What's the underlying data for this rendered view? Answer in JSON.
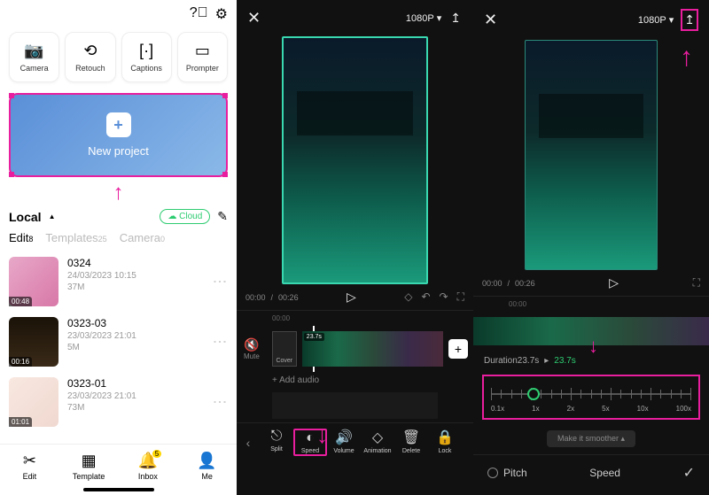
{
  "left": {
    "tools": [
      {
        "icon": "📷",
        "label": "Camera"
      },
      {
        "icon": "⟲",
        "label": "Retouch"
      },
      {
        "icon": "[·]",
        "label": "Captions"
      },
      {
        "icon": "▭",
        "label": "Prompter"
      }
    ],
    "new_project": "New project",
    "section_local": "Local",
    "cloud_btn": "☁ Cloud",
    "tabs": {
      "edit": "Edit",
      "edit_count": "8",
      "templates": "Templates",
      "templates_count": "25",
      "camera": "Camera",
      "camera_count": "0"
    },
    "projects": [
      {
        "title": "0324",
        "date": "24/03/2023 10:15",
        "size": "37M",
        "dur": "00:48",
        "bg": "linear-gradient(135deg,#e8a8c8,#d878a8)"
      },
      {
        "title": "0323-03",
        "date": "23/03/2023 21:01",
        "size": "5M",
        "dur": "00:16",
        "bg": "linear-gradient(180deg,#1a1208,#3a2a18)"
      },
      {
        "title": "0323-01",
        "date": "23/03/2023 21:01",
        "size": "73M",
        "dur": "01:01",
        "bg": "linear-gradient(135deg,#f8e8e0,#f0d8d0)"
      }
    ],
    "bottom_nav": [
      {
        "icon": "✂",
        "label": "Edit"
      },
      {
        "icon": "▦",
        "label": "Template"
      },
      {
        "icon": "🔔",
        "label": "Inbox",
        "badge": "5"
      },
      {
        "icon": "👤",
        "label": "Me"
      }
    ]
  },
  "mid": {
    "resolution": "1080P",
    "time_current": "00:00",
    "time_total": "00:26",
    "ruler_mark": "00:00",
    "mute": "Mute",
    "cover": "Cover",
    "clip_dur": "23.7s",
    "add_audio": "+ Add audio",
    "tools": [
      {
        "icon": "⎋",
        "label": "Split"
      },
      {
        "icon": "◐",
        "label": "Speed",
        "hl": true
      },
      {
        "icon": "🔊",
        "label": "Volume"
      },
      {
        "icon": "◇",
        "label": "Animation"
      },
      {
        "icon": "🗑",
        "label": "Delete"
      },
      {
        "icon": "🔒",
        "label": "Lock"
      }
    ]
  },
  "right": {
    "resolution": "1080P",
    "time_current": "00:00",
    "time_total": "00:26",
    "ruler_mark": "00:00",
    "duration_label": "Duration23.7s",
    "duration_new": "23.7s",
    "speed_marks": [
      "0.1x",
      "1x",
      "2x",
      "5x",
      "10x",
      "100x"
    ],
    "smoother": "Make it smoother",
    "pitch": "Pitch",
    "speed_title": "Speed"
  }
}
